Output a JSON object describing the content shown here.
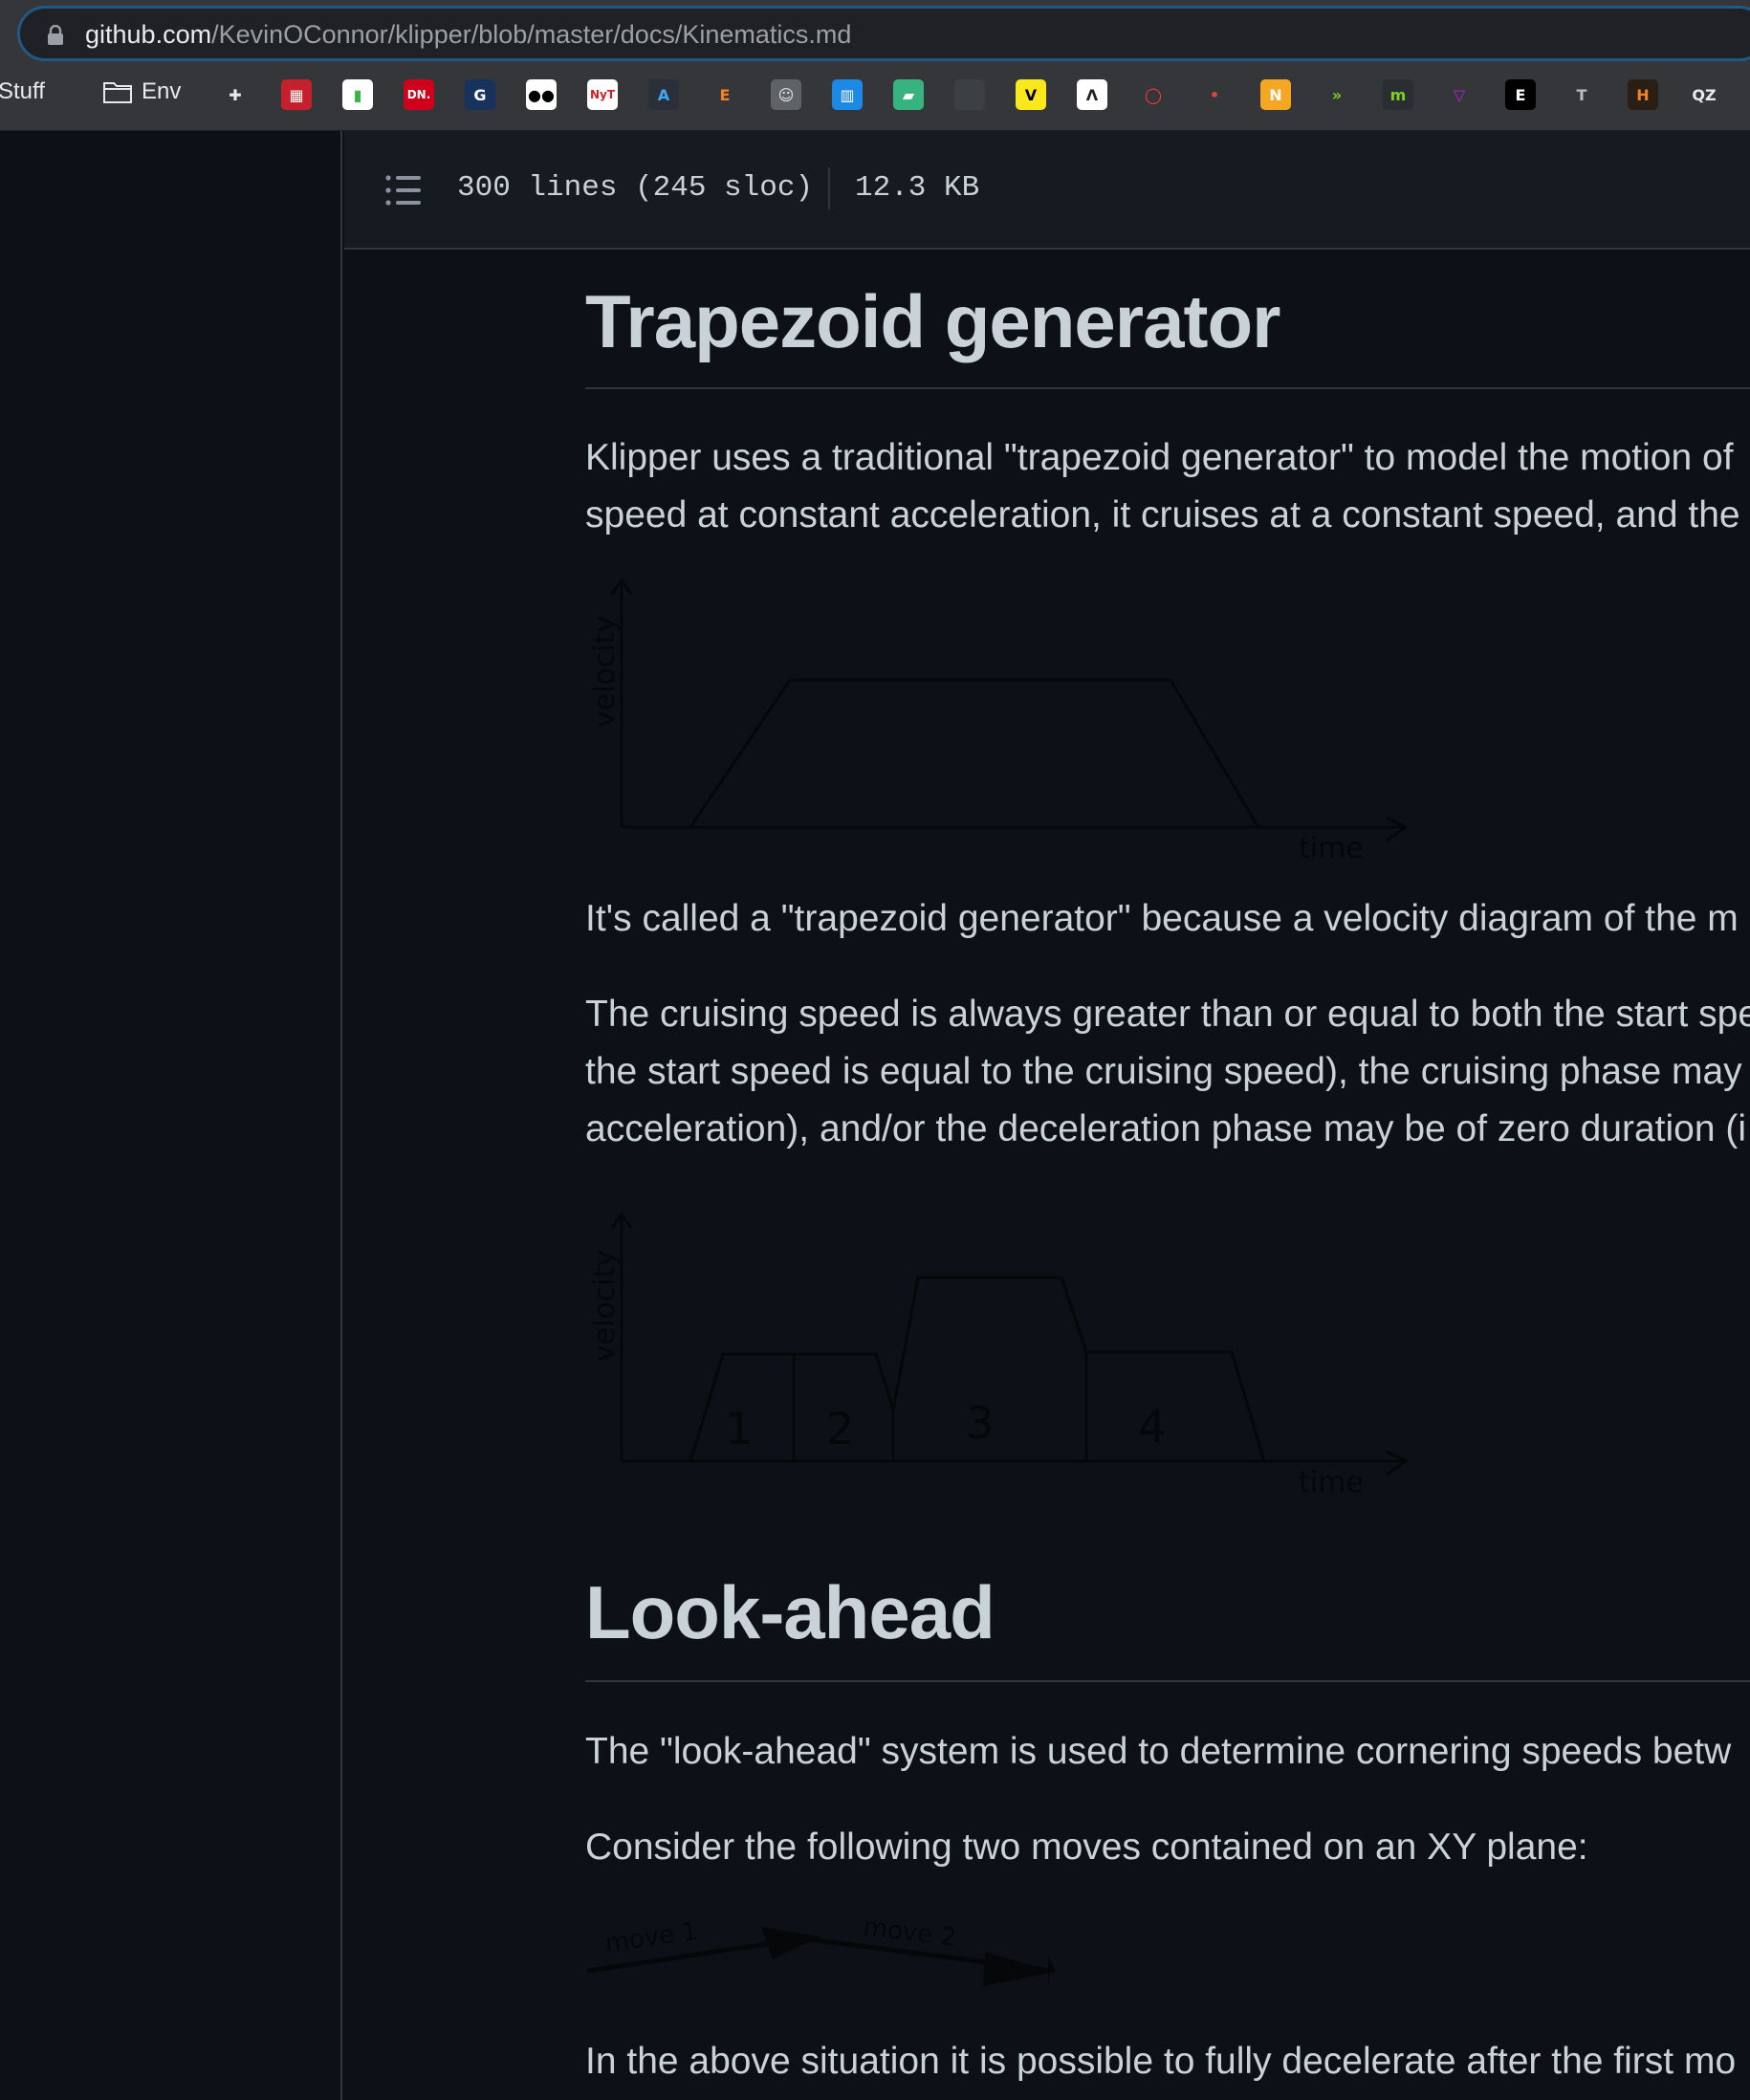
{
  "browser": {
    "url_host": "github.com",
    "url_path": "/KevinOConnor/klipper/blob/master/docs/Kinematics.md",
    "bookmarks": {
      "folders": [
        {
          "label": "Stuff"
        },
        {
          "label": "Env"
        }
      ],
      "icons": [
        {
          "name": "slack-icon",
          "text": "✚",
          "color": "#e8eaed",
          "bg": "transparent"
        },
        {
          "name": "red-grid-icon",
          "text": "▦",
          "color": "#ffffff",
          "bg": "#c4202e"
        },
        {
          "name": "chart-icon",
          "text": "▮",
          "color": "#3bb34a",
          "bg": "#ffffff"
        },
        {
          "name": "dn-icon",
          "text": "DN.",
          "color": "#ffffff",
          "bg": "#d0021b"
        },
        {
          "name": "g-icon",
          "text": "G",
          "color": "#ffffff",
          "bg": "#18325e"
        },
        {
          "name": "medium-icon",
          "text": "●●",
          "color": "#000000",
          "bg": "#ffffff"
        },
        {
          "name": "nyt-icon",
          "text": "NyT",
          "color": "#cc1f2a",
          "bg": "#ffffff"
        },
        {
          "name": "a-icon",
          "text": "A",
          "color": "#3fa9f5",
          "bg": "#2b2f3a"
        },
        {
          "name": "e-icon",
          "text": "E",
          "color": "#f58220",
          "bg": "transparent"
        },
        {
          "name": "face-icon",
          "text": "☺",
          "color": "#e8eaed",
          "bg": "#5f6368"
        },
        {
          "name": "blue-bars-icon",
          "text": "▥",
          "color": "#ffffff",
          "bg": "#1e88e5"
        },
        {
          "name": "green-slash-icon",
          "text": "▰",
          "color": "#ffffff",
          "bg": "#36b37e"
        },
        {
          "name": "dark-icon",
          "text": "",
          "color": "#ffffff",
          "bg": "#3c3f44"
        },
        {
          "name": "v-icon",
          "text": "V",
          "color": "#000000",
          "bg": "#f8e81c"
        },
        {
          "name": "arrow-up-icon",
          "text": "Λ",
          "color": "#202124",
          "bg": "#ffffff"
        },
        {
          "name": "speech-icon",
          "text": "◯",
          "color": "#ff3b30",
          "bg": "transparent"
        },
        {
          "name": "dots-icon",
          "text": "•",
          "color": "#e0443e",
          "bg": "transparent"
        },
        {
          "name": "n-icon",
          "text": "N",
          "color": "#ffffff",
          "bg": "#f5a623"
        },
        {
          "name": "arrows-icon",
          "text": "»",
          "color": "#7ed321",
          "bg": "transparent"
        },
        {
          "name": "m-icon",
          "text": "m",
          "color": "#7ed321",
          "bg": "#2a2d31"
        },
        {
          "name": "triangle-icon",
          "text": "▽",
          "color": "#b620e0",
          "bg": "transparent"
        },
        {
          "name": "e-box-icon",
          "text": "E",
          "color": "#ffffff",
          "bg": "#000000"
        },
        {
          "name": "t-icon",
          "text": "T",
          "color": "#bdbdbd",
          "bg": "transparent"
        },
        {
          "name": "h-icon",
          "text": "H",
          "color": "#f58220",
          "bg": "#2a1f14"
        },
        {
          "name": "qz-icon",
          "text": "QZ",
          "color": "#e8eaed",
          "bg": "transparent"
        }
      ]
    }
  },
  "file_header": {
    "lines": "300 lines (245 sloc)",
    "size": "12.3 KB"
  },
  "article": {
    "h1_trapezoid": "Trapezoid generator",
    "p1_line1": "Klipper uses a traditional \"trapezoid generator\" to model the motion of",
    "p1_line2": "speed at constant acceleration, it cruises at a constant speed, and the",
    "fig1": {
      "ylabel": "velocity",
      "xlabel": "time"
    },
    "p2_line1": "It's called a \"trapezoid generator\" because a velocity diagram of the m",
    "p3_line1": "The cruising speed is always greater than or equal to both the start spe",
    "p3_line2": "the start speed is equal to the cruising speed), the cruising phase may",
    "p3_line3": "acceleration), and/or the deceleration phase may be of zero duration (i",
    "fig2": {
      "ylabel": "velocity",
      "xlabel": "time",
      "labels": [
        "1",
        "2",
        "3",
        "4"
      ]
    },
    "h1_lookahead": "Look-ahead",
    "p4_line1": "The \"look-ahead\" system is used to determine cornering speeds betw",
    "p5_line1": "Consider the following two moves contained on an XY plane:",
    "fig3": {
      "label1": "move 1",
      "label2": "move 2"
    },
    "p6_line1": "In the above situation it is possible to fully decelerate after the first mo"
  }
}
